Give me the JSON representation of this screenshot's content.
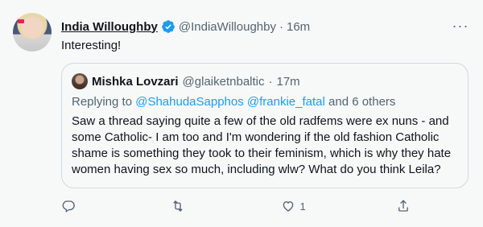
{
  "tweet": {
    "display_name": "India Willoughby",
    "handle": "@IndiaWilloughby",
    "separator": "·",
    "time": "16m",
    "text": "Interesting!",
    "more_label": "···"
  },
  "quote": {
    "display_name": "Mishka Lovzari",
    "handle": "@glaiketnbaltic",
    "separator": "·",
    "time": "17m",
    "replying_prefix": "Replying to",
    "replying_users": "@ShahudaSapphos @frankie_fatal",
    "replying_suffix": "and 6 others",
    "text": "Saw a thread saying quite a few of the old radfems were ex nuns - and some Catholic- I am too and I'm wondering if the old fashion Catholic shame is something they took to their feminism, which is why they hate women having sex so much, including wlw? What do you think Leila?"
  },
  "actions": {
    "reply": {
      "icon": "reply-icon",
      "count": ""
    },
    "retweet": {
      "icon": "retweet-icon",
      "count": ""
    },
    "like": {
      "icon": "heart-icon",
      "count": "1"
    },
    "share": {
      "icon": "share-icon",
      "count": ""
    }
  },
  "colors": {
    "background": "#f7f9f9",
    "accent": "#1d9bf0",
    "muted": "#536471",
    "border": "#cfd9de"
  }
}
